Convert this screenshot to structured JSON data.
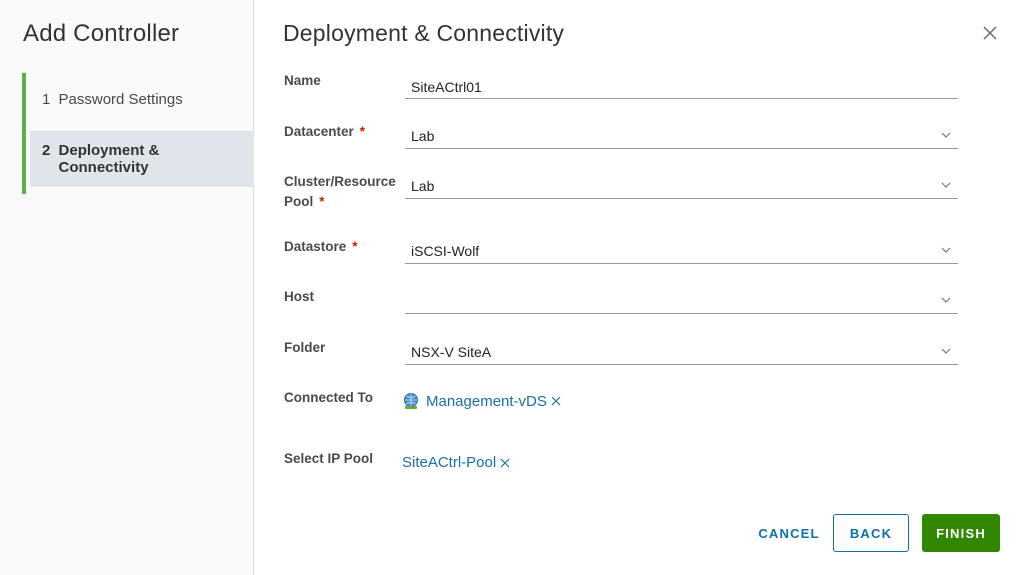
{
  "sidebar": {
    "title": "Add Controller",
    "steps": [
      {
        "number": "1",
        "label": "Password Settings"
      },
      {
        "number": "2",
        "label": "Deployment & Connectivity"
      }
    ]
  },
  "main": {
    "title": "Deployment & Connectivity",
    "fields": {
      "name": {
        "label": "Name",
        "value": "SiteACtrl01"
      },
      "datacenter": {
        "label": "Datacenter",
        "value": "Lab",
        "required": "*"
      },
      "cluster": {
        "label": "Cluster/Resource Pool",
        "value": "Lab",
        "required": "*"
      },
      "datastore": {
        "label": "Datastore",
        "value": "iSCSI-Wolf",
        "required": "*"
      },
      "host": {
        "label": "Host",
        "value": ""
      },
      "folder": {
        "label": "Folder",
        "value": "NSX-V SiteA"
      },
      "connected_to": {
        "label": "Connected To",
        "value": "Management-vDS"
      },
      "ip_pool": {
        "label": "Select IP Pool",
        "value": "SiteACtrl-Pool"
      }
    },
    "buttons": {
      "cancel": "CANCEL",
      "back": "BACK",
      "finish": "FINISH"
    }
  },
  "colors": {
    "accent_green": "#5eb14a",
    "link_blue": "#1a6fa8",
    "finish_green": "#318700",
    "required_red": "#c92100"
  }
}
